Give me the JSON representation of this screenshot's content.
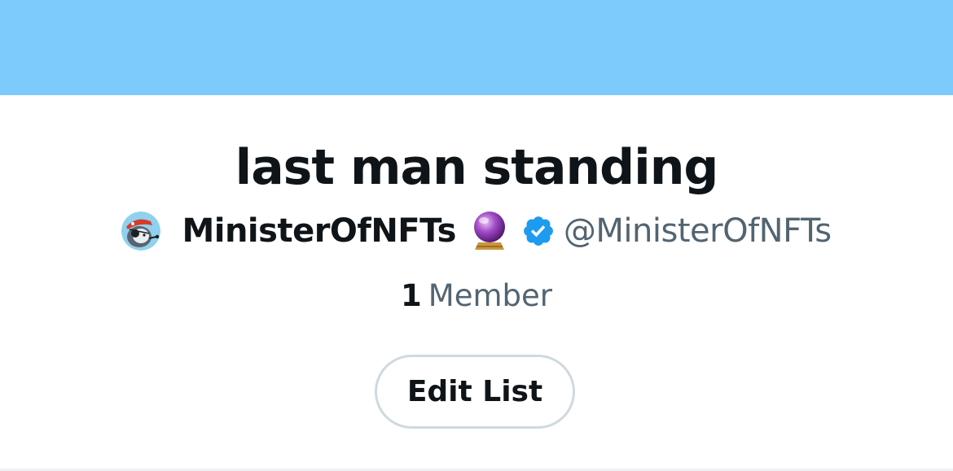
{
  "header": {
    "banner_color": "#7dcbfc"
  },
  "list": {
    "title": "last man standing",
    "owner": {
      "display_name": "MinisterOfNFTs",
      "emoji_icon": "crystal-ball-emoji",
      "verified_icon": "verified-badge-icon",
      "handle": "@MinisterOfNFTs"
    },
    "member_count": "1",
    "member_label": "Member"
  },
  "actions": {
    "edit_label": "Edit List"
  },
  "colors": {
    "primary_text": "#0f1419",
    "secondary_text": "#536471",
    "verified_blue": "#1d9bf0",
    "button_border": "#cfd9de"
  }
}
